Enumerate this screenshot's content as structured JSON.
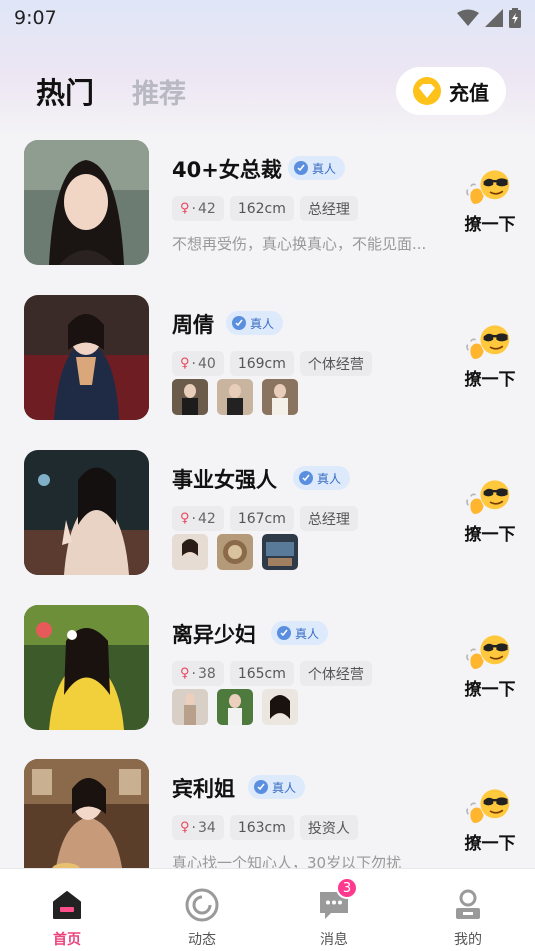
{
  "status_bar": {
    "time": "9:07"
  },
  "header": {
    "tabs": [
      {
        "label": "热门"
      },
      {
        "label": "推荐"
      }
    ],
    "recharge_label": "充值",
    "recharge_color": "#ffc21a"
  },
  "colors": {
    "accent": "#e8457e",
    "verified_bg": "#dceafb",
    "badge": "#ff3a8e"
  },
  "cards": [
    {
      "name": "40+女总裁",
      "verified": "真人",
      "age": "42",
      "height": "162cm",
      "job": "总经理",
      "description": "不想再受伤，真心换真心，不能见面...",
      "wave_label": "撩一下"
    },
    {
      "name": "周倩",
      "verified": "真人",
      "age": "40",
      "height": "169cm",
      "job": "个体经营",
      "wave_label": "撩一下"
    },
    {
      "name": "事业女强人",
      "verified": "真人",
      "age": "42",
      "height": "167cm",
      "job": "总经理",
      "wave_label": "撩一下"
    },
    {
      "name": "离异少妇",
      "verified": "真人",
      "age": "38",
      "height": "165cm",
      "job": "个体经营",
      "wave_label": "撩一下"
    },
    {
      "name": "宾利姐",
      "verified": "真人",
      "age": "34",
      "height": "163cm",
      "job": "投资人",
      "description": "真心找一个知心人，30岁以下勿扰",
      "wave_label": "撩一下"
    }
  ],
  "bottom_nav": {
    "items": [
      {
        "label": "首页",
        "icon": "home-icon"
      },
      {
        "label": "动态",
        "icon": "moments-icon"
      },
      {
        "label": "消息",
        "icon": "message-icon",
        "badge": "3"
      },
      {
        "label": "我的",
        "icon": "profile-icon"
      }
    ]
  }
}
